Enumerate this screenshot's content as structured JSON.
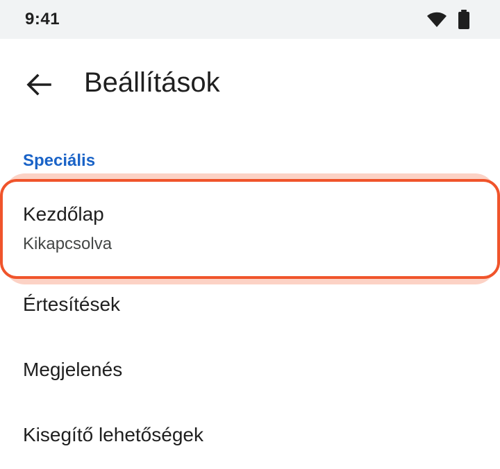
{
  "status_bar": {
    "time": "9:41",
    "wifi_icon": "wifi-icon",
    "battery_icon": "battery-icon"
  },
  "toolbar": {
    "back_icon": "arrow-left-icon",
    "title": "Beállítások"
  },
  "section": {
    "header": "Speciális",
    "items": [
      {
        "title": "Kezdőlap",
        "subtitle": "Kikapcsolva",
        "highlighted": true
      },
      {
        "title": "Értesítések"
      },
      {
        "title": "Megjelenés"
      },
      {
        "title": "Kisegítő lehetőségek"
      }
    ]
  },
  "colors": {
    "accent_blue": "#1a63c7",
    "highlight_border": "#f0542b",
    "highlight_halo": "#fcd2c5",
    "status_bar_bg": "#f1f3f4"
  }
}
